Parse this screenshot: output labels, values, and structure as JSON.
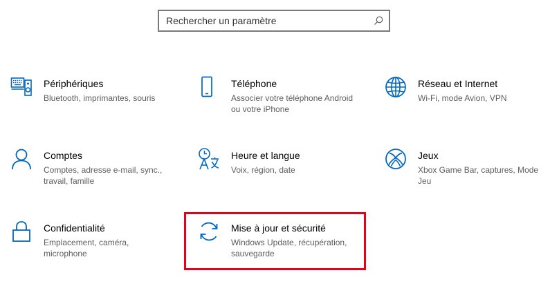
{
  "search": {
    "placeholder": "Rechercher un paramètre",
    "icon": "search-icon"
  },
  "accent_color": "#0067c0",
  "highlight_color": "#e5001b",
  "tiles": [
    {
      "title": "Périphériques",
      "description": "Bluetooth, imprimantes, souris",
      "icon": "devices-icon"
    },
    {
      "title": "Téléphone",
      "description": "Associer votre téléphone Android ou votre iPhone",
      "icon": "phone-icon"
    },
    {
      "title": "Réseau et Internet",
      "description": "Wi-Fi, mode Avion, VPN",
      "icon": "globe-icon"
    },
    {
      "title": "Comptes",
      "description": "Comptes, adresse e-mail, sync., travail, famille",
      "icon": "person-icon"
    },
    {
      "title": "Heure et langue",
      "description": "Voix, région, date",
      "icon": "time-language-icon"
    },
    {
      "title": "Jeux",
      "description": "Xbox Game Bar, captures, Mode Jeu",
      "icon": "xbox-icon"
    },
    {
      "title": "Confidentialité",
      "description": "Emplacement, caméra, microphone",
      "icon": "lock-icon"
    },
    {
      "title": "Mise à jour et sécurité",
      "description": "Windows Update, récupération, sauvegarde",
      "icon": "update-icon"
    }
  ]
}
